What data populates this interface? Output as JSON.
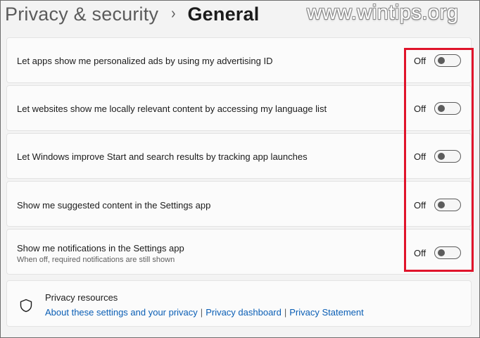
{
  "header": {
    "parent": "Privacy & security",
    "separator": "›",
    "current": "General"
  },
  "watermark": "www.wintips.org",
  "settings": [
    {
      "label": "Let apps show me personalized ads by using my advertising ID",
      "state": "Off"
    },
    {
      "label": "Let websites show me locally relevant content by accessing my language list",
      "state": "Off"
    },
    {
      "label": "Let Windows improve Start and search results by tracking app launches",
      "state": "Off"
    },
    {
      "label": "Show me suggested content in the Settings app",
      "state": "Off"
    },
    {
      "label": "Show me notifications in the Settings app",
      "sublabel": "When off, required notifications are still shown",
      "state": "Off"
    }
  ],
  "resources": {
    "title": "Privacy resources",
    "links": [
      "About these settings and your privacy",
      "Privacy dashboard",
      "Privacy Statement"
    ],
    "link_separator": "|",
    "icon": "shield-icon"
  },
  "colors": {
    "background": "#f3f3f3",
    "card": "#fbfbfb",
    "link": "#0a5eb5",
    "highlight": "#e0142b",
    "toggle_off": "#5c5c5c"
  }
}
